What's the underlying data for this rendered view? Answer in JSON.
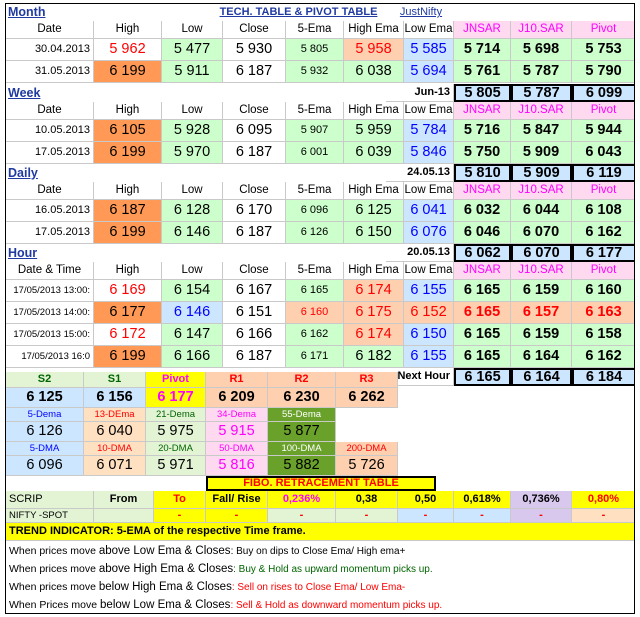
{
  "colors": {
    "red": "#ff0000",
    "blue": "#0000ff",
    "magenta": "#ff00ff",
    "navy": "#1f3aa0",
    "green_bg": "#ccffcc",
    "light_green_bg": "#e3f4d5",
    "blue_bg": "#cce6ff",
    "orange_bg": "#ff9955",
    "salmon_bg": "#ffd0b0",
    "pink_bg": "#ffd9f0",
    "yellow_bg": "#ffff00",
    "peach_bg": "#ffe0c0",
    "purple_bg": "#d8c8ee",
    "olive_bg": "#6aa12b"
  },
  "header": {
    "month_label": "Month",
    "title": "TECH. TABLE  &  PIVOT TABLE",
    "brand": "JustNifty"
  },
  "col_headers": [
    "Date",
    "High",
    "Low",
    "Close",
    "5-Ema",
    "High Ema",
    "Low Ema",
    "JNSAR",
    "J10.SAR",
    "Pivot"
  ],
  "month": {
    "rows": [
      [
        "30.04.2013",
        "5 962",
        "5 477",
        "5 930",
        "5 805",
        "5 958",
        "5 585",
        "5 714",
        "5 698",
        "5 753"
      ],
      [
        "31.05.2013",
        "6 199",
        "5 911",
        "6 187",
        "5 932",
        "6 038",
        "5 694",
        "5 761",
        "5 787",
        "5 790"
      ]
    ]
  },
  "week": {
    "label": "Week",
    "period": "Jun-13",
    "next": [
      "5 805",
      "5 787",
      "6 099"
    ],
    "rows": [
      [
        "10.05.2013",
        "6 105",
        "5 928",
        "6 095",
        "5 907",
        "5 959",
        "5 784",
        "5 716",
        "5 847",
        "5 944"
      ],
      [
        "17.05.2013",
        "6 199",
        "5 970",
        "6 187",
        "6 001",
        "6 039",
        "5 846",
        "5 750",
        "5 909",
        "6 043"
      ]
    ]
  },
  "daily": {
    "label": "Daily",
    "period": "24.05.13",
    "next": [
      "5 810",
      "5 909",
      "6 119"
    ],
    "rows": [
      [
        "16.05.2013",
        "6 187",
        "6 128",
        "6 170",
        "6 096",
        "6 125",
        "6 041",
        "6 032",
        "6 044",
        "6 108"
      ],
      [
        "17.05.2013",
        "6 199",
        "6 146",
        "6 187",
        "6 126",
        "6 150",
        "6 076",
        "6 046",
        "6 070",
        "6 162"
      ]
    ]
  },
  "hour": {
    "label": "Hour",
    "period": "20.05.13",
    "next": [
      "6 062",
      "6 070",
      "6 177"
    ],
    "date_time_label": "Date & Time",
    "rows": [
      [
        "17/05/2013 13:00:",
        "6 169",
        "6 154",
        "6 167",
        "6 165",
        "6 174",
        "6 155",
        "6 165",
        "6 159",
        "6 160"
      ],
      [
        "17/05/2013 14:00:",
        "6 177",
        "6 146",
        "6 151",
        "6 160",
        "6 175",
        "6 152",
        "6 165",
        "6 157",
        "6 163"
      ],
      [
        "17/05/2013 15:00:",
        "6 172",
        "6 147",
        "6 166",
        "6 162",
        "6 174",
        "6 150",
        "6 165",
        "6 159",
        "6 158"
      ],
      [
        "17/05/2013 16:0",
        "6 199",
        "6 166",
        "6 187",
        "6 171",
        "6 182",
        "6 155",
        "6 165",
        "6 164",
        "6 162"
      ]
    ],
    "next_hour_label": "Next Hour",
    "next_hour": [
      "6 165",
      "6 164",
      "6 184"
    ]
  },
  "pivot": {
    "headers": [
      "S2",
      "S1",
      "Pivot",
      "R1",
      "R2",
      "R3"
    ],
    "values": [
      "6 125",
      "6 156",
      "6 177",
      "6 209",
      "6 230",
      "6 262"
    ]
  },
  "dema": {
    "labels": [
      "5-Dema",
      "13-DEma",
      "21-Dema",
      "34-Dema",
      "55-Dema"
    ],
    "values": [
      "6 126",
      "6 040",
      "5 975",
      "5 915",
      "5 877"
    ]
  },
  "dma": {
    "labels": [
      "5-DMA",
      "10-DMA",
      "20-DMA",
      "50-DMA",
      "100-DMA",
      "200-DMA"
    ],
    "values": [
      "6 096",
      "6 071",
      "5 971",
      "5 816",
      "5 882",
      "5 726"
    ]
  },
  "fibo": {
    "title": "FIBO. RETRACEMENT TABLE",
    "headers": [
      "SCRIP",
      "From",
      "To",
      "Fall/ Rise",
      "0,236%",
      "0,38",
      "0,50",
      "0,618%",
      "0,736%",
      "0,80%"
    ],
    "row_label": "NIFTY -SPOT",
    "row_values": [
      "-",
      "-",
      "-",
      "-",
      "-",
      "-",
      "-",
      "-"
    ]
  },
  "trend": {
    "title": "TREND INDICATOR: 5-EMA of the respective Time frame.",
    "lines": [
      {
        "pre": "When prices move ",
        "key": "above Low Ema & Closes",
        "post": ": Buy on dips to Close Ema/ High ema+"
      },
      {
        "pre": "When prices move ",
        "key": "above High Ema & Closes",
        "post": ": Buy & Hold as upward momentum picks up."
      },
      {
        "pre": "When prices move ",
        "key": "below High Ema & Closes",
        "post": ": Sell on rises to Close Ema/ Low Ema-"
      },
      {
        "pre": "When Prices move ",
        "key": "below Low Ema & Closes",
        "post": ": Sell & Hold as downward momentum picks up."
      }
    ]
  }
}
